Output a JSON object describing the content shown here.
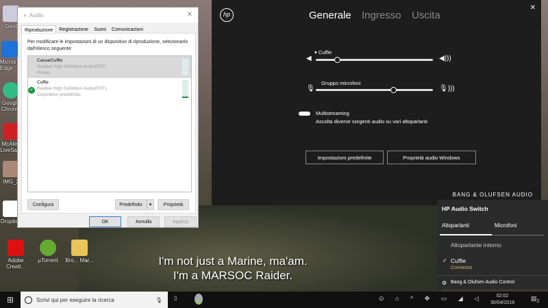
{
  "desktop": {
    "icons": [
      "Gest",
      "Micros Edge",
      "Google Chrome",
      "McAfee LiveSafe",
      "IMG_2",
      "Dropbox",
      "Adobe Creati...",
      "µTorrent",
      "Bro... Mar..."
    ],
    "subtitle": [
      "I'm not just a Marine, ma'am.",
      "I'm a MARSOC Raider."
    ]
  },
  "audio_dialog": {
    "title": "Audio",
    "close": "✕",
    "tabs": [
      "Riproduzione",
      "Registrazione",
      "Suoni",
      "Comunicazioni"
    ],
    "description": "Per modificare le impostazioni di un dispositivo di riproduzione, selezionarlo dall'elenco seguente:",
    "devices": [
      {
        "name": "Cassa/Cuffie",
        "driver": "Realtek High Definition Audio(SST)",
        "status": "Pronto"
      },
      {
        "name": "Cuffie",
        "driver": "Realtek High Definition Audio(SST)",
        "status": "Dispositivo predefinito"
      }
    ],
    "buttons": {
      "configure": "Configura",
      "default": "Predefinito",
      "properties": "Proprietà",
      "ok": "OK",
      "cancel": "Annulla",
      "apply": "Applica"
    }
  },
  "hp_app": {
    "logo": "hp",
    "tabs": [
      "Generale",
      "Ingresso",
      "Uscita"
    ],
    "close": "✕",
    "output": {
      "label": "Cuffie",
      "volume_percent": 18
    },
    "mic": {
      "label": "Gruppo microfoni",
      "volume_percent": 66
    },
    "multistreaming": {
      "label": "Multistreaming",
      "desc": "Ascolta diverse sorgenti audio su vari altoparlanti",
      "enabled": true
    },
    "buttons": [
      "Impostazioni predefinite",
      "Proprietà audio Windows"
    ],
    "brand": "BANG & OLUFSEN AUDIO"
  },
  "audio_switch": {
    "title": "HP Audio Switch",
    "tabs": [
      "Altoparlanti",
      "Microfoni"
    ],
    "items": [
      {
        "name": "Altoparlante interno"
      },
      {
        "name": "Cuffie",
        "status": "Connesso"
      }
    ],
    "footer": "Bang & Olufsen Audio Control"
  },
  "taskbar": {
    "search_placeholder": "Scrivi qui per eseguire la ricerca",
    "time": "02:02",
    "date": "30/04/2019",
    "notifications": "2"
  }
}
